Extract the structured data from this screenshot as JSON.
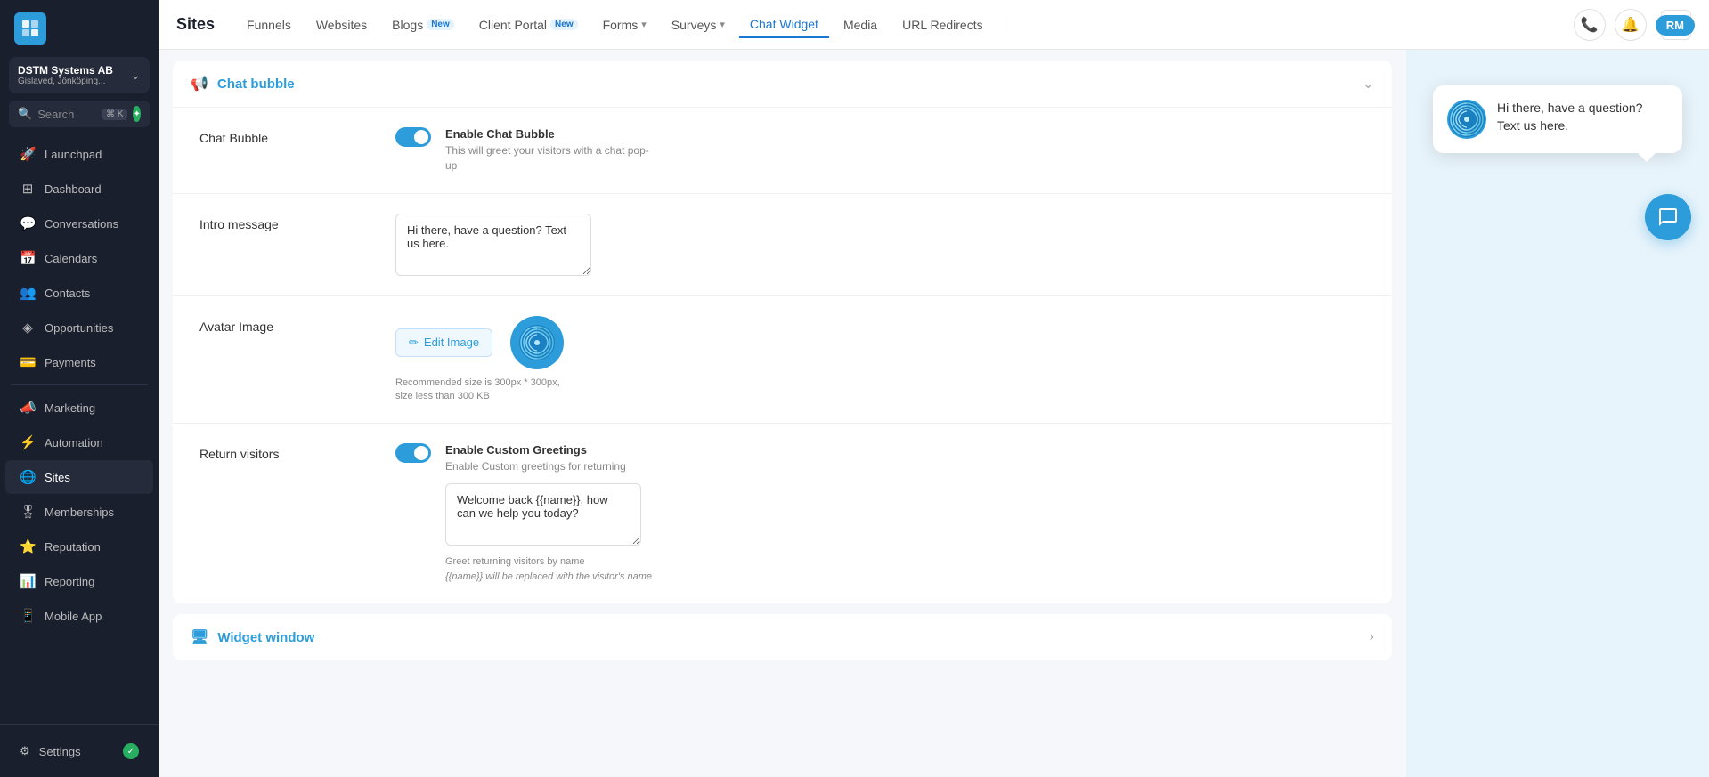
{
  "app": {
    "title": "Sites"
  },
  "account": {
    "name": "DSTM Systems AB",
    "sub": "Gislaved, Jönköping..."
  },
  "sidebar": {
    "search_placeholder": "Search",
    "search_shortcut": "⌘ K",
    "items": [
      {
        "id": "launchpad",
        "label": "Launchpad",
        "icon": "🚀"
      },
      {
        "id": "dashboard",
        "label": "Dashboard",
        "icon": "⊞"
      },
      {
        "id": "conversations",
        "label": "Conversations",
        "icon": "💬"
      },
      {
        "id": "calendars",
        "label": "Calendars",
        "icon": "📅"
      },
      {
        "id": "contacts",
        "label": "Contacts",
        "icon": "👥"
      },
      {
        "id": "opportunities",
        "label": "Opportunities",
        "icon": "◈"
      },
      {
        "id": "payments",
        "label": "Payments",
        "icon": "💳"
      },
      {
        "id": "marketing",
        "label": "Marketing",
        "icon": "📣"
      },
      {
        "id": "automation",
        "label": "Automation",
        "icon": "⚡"
      },
      {
        "id": "sites",
        "label": "Sites",
        "icon": "🌐",
        "active": true
      },
      {
        "id": "memberships",
        "label": "Memberships",
        "icon": "🎖"
      },
      {
        "id": "reputation",
        "label": "Reputation",
        "icon": "⭐"
      },
      {
        "id": "reporting",
        "label": "Reporting",
        "icon": "📊"
      },
      {
        "id": "mobile-app",
        "label": "Mobile App",
        "icon": "📱"
      }
    ],
    "settings_label": "Settings"
  },
  "top_nav": {
    "items": [
      {
        "id": "funnels",
        "label": "Funnels",
        "active": false
      },
      {
        "id": "websites",
        "label": "Websites",
        "active": false
      },
      {
        "id": "blogs",
        "label": "Blogs",
        "active": false,
        "badge": "New"
      },
      {
        "id": "client-portal",
        "label": "Client Portal",
        "active": false,
        "badge": "New"
      },
      {
        "id": "forms",
        "label": "Forms",
        "active": false,
        "dropdown": true
      },
      {
        "id": "surveys",
        "label": "Surveys",
        "active": false,
        "dropdown": true
      },
      {
        "id": "chat-widget",
        "label": "Chat Widget",
        "active": true
      },
      {
        "id": "media",
        "label": "Media",
        "active": false
      },
      {
        "id": "url-redirects",
        "label": "URL Redirects",
        "active": false
      }
    ]
  },
  "sections": {
    "chat_bubble": {
      "title": "Chat bubble",
      "settings": {
        "chat_bubble_label": "Chat Bubble",
        "enable_title": "Enable Chat Bubble",
        "enable_desc": "This will greet your visitors with a chat pop-up",
        "toggle_on": true,
        "intro_message_label": "Intro message",
        "intro_message_value": "Hi there, have a question? Text us here.",
        "avatar_image_label": "Avatar Image",
        "edit_image_btn": "Edit Image",
        "avatar_hint": "Recommended size is 300px * 300px, size less than 300 KB",
        "return_visitors_label": "Return visitors",
        "custom_greetings_title": "Enable Custom Greetings",
        "custom_greetings_desc": "Enable Custom greetings for returning",
        "return_toggle_on": true,
        "return_message_value": "Welcome back {{name}}, how can we help you today?",
        "greetings_hint_line1": "Greet returning visitors by name",
        "greetings_hint_line2": "{{name}} will be replaced with the visitor's name"
      }
    },
    "widget_window": {
      "title": "Widget window"
    }
  },
  "preview": {
    "message": "Hi there, have a question? Text us here."
  },
  "topbar": {
    "avatar_label": "RM"
  }
}
